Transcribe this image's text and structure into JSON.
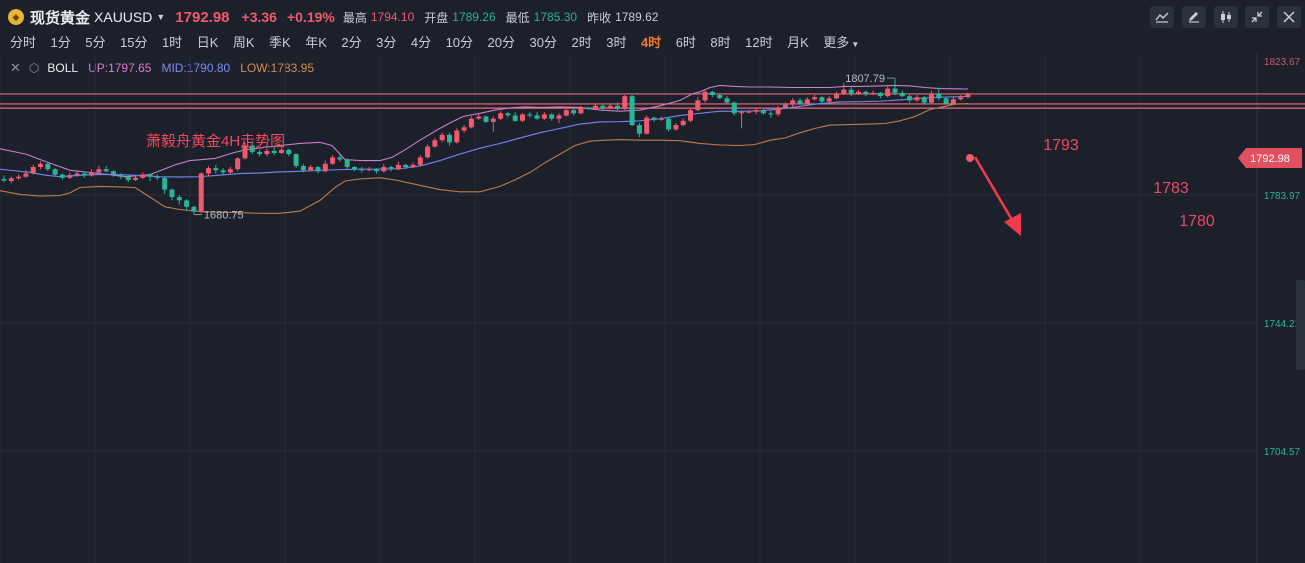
{
  "header": {
    "instrument_name": "现货黄金",
    "instrument_code": "XAUUSD",
    "price": "1792.98",
    "change": "+3.36",
    "change_pct": "+0.19%",
    "quotes": [
      {
        "label": "最高",
        "value": "1794.10",
        "tone": "up"
      },
      {
        "label": "开盘",
        "value": "1789.26",
        "tone": "dn"
      },
      {
        "label": "最低",
        "value": "1785.30",
        "tone": "dn"
      },
      {
        "label": "昨收",
        "value": "1789.62",
        "tone": "nt"
      }
    ],
    "toolbar_icons": [
      "area-chart-icon",
      "pen-icon",
      "candlestick-icon",
      "shrink-icon",
      "close-icon"
    ]
  },
  "timeframes": [
    "分时",
    "1分",
    "5分",
    "15分",
    "1时",
    "日K",
    "周K",
    "季K",
    "年K",
    "2分",
    "3分",
    "4分",
    "10分",
    "20分",
    "30分",
    "2时",
    "3时",
    "4时",
    "6时",
    "8时",
    "12时",
    "月K"
  ],
  "active_timeframe": "4时",
  "more_label": "更多",
  "indicator": {
    "name": "BOLL",
    "up": "UP:1797.65",
    "mid": "MID:1790.80",
    "low": "LOW:1783.95"
  },
  "colors": {
    "up": "#ef5a6f",
    "down": "#2bb49a",
    "boll_up": "#c97fc9",
    "boll_mid": "#6f7fe6",
    "boll_low": "#c07a4a",
    "line": "#e96d7d",
    "bg": "#1c202b"
  },
  "chart_data": {
    "type": "candlestick",
    "title": "萧毅舟黄金4H走势图",
    "ylim": [
      1678,
      1826
    ],
    "y_ticks": [
      "1823.67",
      "1744.21",
      "1704.57"
    ],
    "current_price_label": "1792.98",
    "right_label_1783": "1783.97",
    "max_label": "1807.79",
    "min_label": "1680.75",
    "levels": [
      {
        "label": "1793",
        "value": 1793
      },
      {
        "label": "1783",
        "value": 1783.7
      },
      {
        "label": "1780",
        "value": 1779.8
      }
    ],
    "forecast": "down",
    "candles": [
      [
        1714,
        1712.5,
        1717,
        1711
      ],
      [
        1712,
        1714.5,
        1716,
        1710
      ],
      [
        1714.5,
        1716,
        1718,
        1713
      ],
      [
        1716,
        1719,
        1722,
        1715
      ],
      [
        1719,
        1725,
        1727,
        1718
      ],
      [
        1725,
        1728,
        1730,
        1723
      ],
      [
        1728,
        1723,
        1729,
        1721
      ],
      [
        1723,
        1718,
        1724,
        1716
      ],
      [
        1718,
        1715,
        1719,
        1713
      ],
      [
        1715,
        1717.5,
        1720,
        1714
      ],
      [
        1717.5,
        1719,
        1721,
        1716
      ],
      [
        1719,
        1717,
        1720,
        1715
      ],
      [
        1717,
        1720,
        1723,
        1716
      ],
      [
        1720,
        1723,
        1726,
        1719
      ],
      [
        1723,
        1721,
        1726,
        1720
      ],
      [
        1721,
        1718,
        1722,
        1716
      ],
      [
        1718,
        1716,
        1719,
        1714
      ],
      [
        1716,
        1713,
        1717,
        1711
      ],
      [
        1713,
        1715,
        1717,
        1712
      ],
      [
        1715,
        1718,
        1720,
        1714
      ],
      [
        1718,
        1716,
        1719,
        1712
      ],
      [
        1716,
        1715,
        1718,
        1713
      ],
      [
        1715,
        1704,
        1716,
        1700
      ],
      [
        1704,
        1697,
        1705,
        1694
      ],
      [
        1697,
        1694,
        1699,
        1690
      ],
      [
        1694,
        1688,
        1695,
        1684
      ],
      [
        1688,
        1683.5,
        1689,
        1680.75
      ],
      [
        1683.5,
        1719,
        1720,
        1682
      ],
      [
        1719,
        1724,
        1726,
        1716
      ],
      [
        1724,
        1722,
        1727,
        1719
      ],
      [
        1722,
        1720,
        1724,
        1717
      ],
      [
        1720,
        1723,
        1725,
        1719
      ],
      [
        1723,
        1733,
        1734,
        1721
      ],
      [
        1733,
        1745,
        1748,
        1732
      ],
      [
        1745,
        1739,
        1749,
        1737
      ],
      [
        1739,
        1737,
        1741,
        1735
      ],
      [
        1737,
        1740,
        1742,
        1735
      ],
      [
        1740,
        1738,
        1744,
        1736
      ],
      [
        1738,
        1741,
        1743,
        1737
      ],
      [
        1741,
        1737,
        1742,
        1735
      ],
      [
        1737,
        1726,
        1738,
        1724
      ],
      [
        1726,
        1722,
        1728,
        1720
      ],
      [
        1722,
        1725,
        1727,
        1721
      ],
      [
        1725,
        1721,
        1726,
        1719
      ],
      [
        1721,
        1728,
        1731,
        1720
      ],
      [
        1728,
        1734,
        1736,
        1727
      ],
      [
        1734,
        1732,
        1737,
        1730
      ],
      [
        1732,
        1725,
        1733,
        1723
      ],
      [
        1725,
        1723,
        1726,
        1721
      ],
      [
        1723,
        1722,
        1725,
        1720
      ],
      [
        1722,
        1723,
        1725,
        1721
      ],
      [
        1723,
        1721,
        1724,
        1719
      ],
      [
        1721,
        1725,
        1728,
        1720
      ],
      [
        1725,
        1723,
        1726,
        1721
      ],
      [
        1723,
        1727,
        1730,
        1722
      ],
      [
        1727,
        1725,
        1728,
        1723
      ],
      [
        1725,
        1727,
        1729,
        1724
      ],
      [
        1727,
        1734,
        1736,
        1726
      ],
      [
        1734,
        1744,
        1746,
        1733
      ],
      [
        1744,
        1750,
        1752,
        1743
      ],
      [
        1750,
        1755,
        1757,
        1748
      ],
      [
        1755,
        1748,
        1757,
        1745
      ],
      [
        1748,
        1759,
        1761,
        1747
      ],
      [
        1759,
        1762,
        1764,
        1757
      ],
      [
        1762,
        1770,
        1772,
        1761
      ],
      [
        1770,
        1772,
        1775,
        1769
      ],
      [
        1772,
        1767,
        1773,
        1766
      ],
      [
        1767,
        1770,
        1772,
        1758
      ],
      [
        1770,
        1775,
        1777,
        1769
      ],
      [
        1775,
        1773,
        1776,
        1771
      ],
      [
        1773,
        1768,
        1776,
        1767
      ],
      [
        1768,
        1774,
        1775,
        1767
      ],
      [
        1774,
        1773,
        1776,
        1771
      ],
      [
        1773,
        1770,
        1776,
        1769
      ],
      [
        1770,
        1774,
        1776,
        1769
      ],
      [
        1774,
        1770,
        1775,
        1768
      ],
      [
        1770,
        1773,
        1775,
        1766
      ],
      [
        1773,
        1778,
        1780,
        1772
      ],
      [
        1778,
        1775,
        1779,
        1773
      ],
      [
        1775,
        1780,
        1782,
        1774
      ],
      [
        1780,
        1779,
        1781,
        1778
      ],
      [
        1779,
        1782,
        1784,
        1778
      ],
      [
        1782,
        1780,
        1783,
        1777
      ],
      [
        1780,
        1782,
        1784,
        1779
      ],
      [
        1782,
        1779,
        1785,
        1777
      ],
      [
        1779,
        1791,
        1792,
        1778
      ],
      [
        1791,
        1764,
        1792,
        1763
      ],
      [
        1764,
        1756,
        1766,
        1753
      ],
      [
        1756,
        1771,
        1773,
        1755
      ],
      [
        1771,
        1769,
        1772,
        1767
      ],
      [
        1769,
        1770,
        1772,
        1768
      ],
      [
        1770,
        1760,
        1771,
        1758
      ],
      [
        1760,
        1764,
        1766,
        1759
      ],
      [
        1764,
        1768,
        1770,
        1763
      ],
      [
        1768,
        1778,
        1780,
        1767
      ],
      [
        1778,
        1787,
        1790,
        1777
      ],
      [
        1787,
        1795,
        1797,
        1785
      ],
      [
        1795,
        1792,
        1796,
        1790
      ],
      [
        1792,
        1789,
        1793,
        1788
      ],
      [
        1789,
        1785,
        1791,
        1784
      ],
      [
        1785,
        1775,
        1786,
        1773
      ],
      [
        1775,
        1776,
        1778,
        1761
      ],
      [
        1776,
        1776.5,
        1778,
        1775
      ],
      [
        1776.5,
        1778,
        1780,
        1774
      ],
      [
        1778,
        1775,
        1780,
        1774
      ],
      [
        1775,
        1774,
        1777,
        1771
      ],
      [
        1774,
        1780,
        1782,
        1772
      ],
      [
        1780,
        1783,
        1785,
        1779
      ],
      [
        1783,
        1787,
        1789,
        1781
      ],
      [
        1787,
        1784,
        1789,
        1783
      ],
      [
        1784,
        1788,
        1790,
        1783
      ],
      [
        1788,
        1790,
        1792,
        1787
      ],
      [
        1790,
        1786,
        1791,
        1784
      ],
      [
        1786,
        1789,
        1791,
        1785
      ],
      [
        1789,
        1793,
        1795,
        1788
      ],
      [
        1793,
        1797,
        1803,
        1792
      ],
      [
        1797,
        1793,
        1799,
        1791
      ],
      [
        1793,
        1795,
        1797,
        1792
      ],
      [
        1795,
        1793,
        1796,
        1791
      ],
      [
        1793,
        1794,
        1796,
        1792
      ],
      [
        1794,
        1791,
        1795,
        1789
      ],
      [
        1791,
        1798,
        1800,
        1790
      ],
      [
        1798,
        1794,
        1807.79,
        1792
      ],
      [
        1794,
        1791,
        1796,
        1790
      ],
      [
        1791,
        1787,
        1792,
        1785
      ],
      [
        1787,
        1790,
        1792,
        1786
      ],
      [
        1790,
        1785,
        1791,
        1783
      ],
      [
        1785,
        1793,
        1796,
        1784
      ],
      [
        1793,
        1789,
        1799,
        1787
      ],
      [
        1789,
        1784,
        1790,
        1783
      ],
      [
        1784,
        1788,
        1790,
        1783
      ],
      [
        1788,
        1790,
        1792,
        1787
      ],
      [
        1790,
        1792.98,
        1794.1,
        1789
      ]
    ],
    "boll_upper": [
      [
        0,
        1742
      ],
      [
        26,
        1737
      ],
      [
        40,
        1732
      ],
      [
        55,
        1727
      ],
      [
        70,
        1722
      ],
      [
        100,
        1719
      ],
      [
        125,
        1716
      ],
      [
        150,
        1718
      ],
      [
        175,
        1727
      ],
      [
        190,
        1731
      ],
      [
        215,
        1733
      ],
      [
        232,
        1738
      ],
      [
        245,
        1741
      ],
      [
        262,
        1743
      ],
      [
        280,
        1745
      ],
      [
        300,
        1747
      ],
      [
        320,
        1748
      ],
      [
        332,
        1745
      ],
      [
        345,
        1732
      ],
      [
        360,
        1731
      ],
      [
        380,
        1731
      ],
      [
        392,
        1734
      ],
      [
        405,
        1741
      ],
      [
        420,
        1750
      ],
      [
        438,
        1760
      ],
      [
        452,
        1767
      ],
      [
        463,
        1772
      ],
      [
        480,
        1775
      ],
      [
        495,
        1778
      ],
      [
        510,
        1780
      ],
      [
        525,
        1781
      ],
      [
        540,
        1780.5
      ],
      [
        560,
        1781
      ],
      [
        580,
        1780.5
      ],
      [
        600,
        1778
      ],
      [
        620,
        1777
      ],
      [
        640,
        1778
      ],
      [
        660,
        1782
      ],
      [
        680,
        1787
      ],
      [
        692,
        1793
      ],
      [
        700,
        1795
      ],
      [
        710,
        1799
      ],
      [
        720,
        1801
      ],
      [
        735,
        1800
      ],
      [
        750,
        1799.5
      ],
      [
        770,
        1799.5
      ],
      [
        790,
        1799
      ],
      [
        810,
        1799
      ],
      [
        830,
        1799
      ],
      [
        845,
        1800
      ],
      [
        860,
        1800
      ],
      [
        880,
        1800.5
      ],
      [
        895,
        1801
      ],
      [
        910,
        1800.5
      ],
      [
        925,
        1799
      ],
      [
        940,
        1798
      ],
      [
        955,
        1797.8
      ],
      [
        968,
        1797.65
      ]
    ],
    "boll_mid": [
      [
        0,
        1723
      ],
      [
        15,
        1721.5
      ],
      [
        30,
        1720
      ],
      [
        45,
        1717.5
      ],
      [
        60,
        1716
      ],
      [
        75,
        1717
      ],
      [
        90,
        1718
      ],
      [
        105,
        1718.2
      ],
      [
        120,
        1718
      ],
      [
        140,
        1717
      ],
      [
        160,
        1716
      ],
      [
        180,
        1715.7
      ],
      [
        200,
        1716
      ],
      [
        220,
        1717.5
      ],
      [
        240,
        1719
      ],
      [
        260,
        1719.5
      ],
      [
        280,
        1720.5
      ],
      [
        300,
        1721
      ],
      [
        320,
        1722
      ],
      [
        340,
        1722.5
      ],
      [
        360,
        1723
      ],
      [
        380,
        1723
      ],
      [
        400,
        1723.5
      ],
      [
        420,
        1726
      ],
      [
        440,
        1731
      ],
      [
        460,
        1737
      ],
      [
        480,
        1742.5
      ],
      [
        500,
        1747
      ],
      [
        520,
        1752
      ],
      [
        540,
        1757
      ],
      [
        560,
        1761
      ],
      [
        580,
        1765
      ],
      [
        600,
        1767
      ],
      [
        620,
        1767.2
      ],
      [
        640,
        1768
      ],
      [
        660,
        1770
      ],
      [
        680,
        1773
      ],
      [
        700,
        1775
      ],
      [
        720,
        1777
      ],
      [
        740,
        1776.8
      ],
      [
        760,
        1777.3
      ],
      [
        780,
        1779
      ],
      [
        800,
        1781.5
      ],
      [
        820,
        1784
      ],
      [
        840,
        1785.5
      ],
      [
        860,
        1785.8
      ],
      [
        880,
        1786.3
      ],
      [
        900,
        1787.5
      ],
      [
        920,
        1789
      ],
      [
        940,
        1790
      ],
      [
        955,
        1790.4
      ],
      [
        968,
        1790.8
      ]
    ],
    "boll_lower": [
      [
        0,
        1703
      ],
      [
        20,
        1699.5
      ],
      [
        40,
        1698
      ],
      [
        60,
        1698.5
      ],
      [
        70,
        1701
      ],
      [
        80,
        1706
      ],
      [
        100,
        1707
      ],
      [
        120,
        1706.5
      ],
      [
        135,
        1706
      ],
      [
        150,
        1697
      ],
      [
        165,
        1688
      ],
      [
        180,
        1685.5
      ],
      [
        200,
        1683.5
      ],
      [
        220,
        1683
      ],
      [
        240,
        1682.5
      ],
      [
        260,
        1682
      ],
      [
        280,
        1682
      ],
      [
        300,
        1684
      ],
      [
        320,
        1694
      ],
      [
        335,
        1706
      ],
      [
        345,
        1712
      ],
      [
        360,
        1714
      ],
      [
        380,
        1715
      ],
      [
        395,
        1713
      ],
      [
        410,
        1710
      ],
      [
        425,
        1707
      ],
      [
        440,
        1704
      ],
      [
        460,
        1702
      ],
      [
        480,
        1702
      ],
      [
        500,
        1707
      ],
      [
        515,
        1713
      ],
      [
        530,
        1720
      ],
      [
        545,
        1729
      ],
      [
        560,
        1737
      ],
      [
        575,
        1745
      ],
      [
        590,
        1749
      ],
      [
        605,
        1750
      ],
      [
        620,
        1750.5
      ],
      [
        640,
        1750
      ],
      [
        660,
        1750
      ],
      [
        680,
        1749.5
      ],
      [
        700,
        1747
      ],
      [
        720,
        1745.5
      ],
      [
        740,
        1745
      ],
      [
        755,
        1746
      ],
      [
        770,
        1750
      ],
      [
        785,
        1752
      ],
      [
        800,
        1757
      ],
      [
        815,
        1761
      ],
      [
        830,
        1764
      ],
      [
        850,
        1764.5
      ],
      [
        870,
        1765
      ],
      [
        885,
        1765.5
      ],
      [
        900,
        1768
      ],
      [
        915,
        1772
      ],
      [
        930,
        1778.5
      ],
      [
        945,
        1781.5
      ],
      [
        955,
        1783.5
      ],
      [
        968,
        1783.95
      ]
    ]
  }
}
